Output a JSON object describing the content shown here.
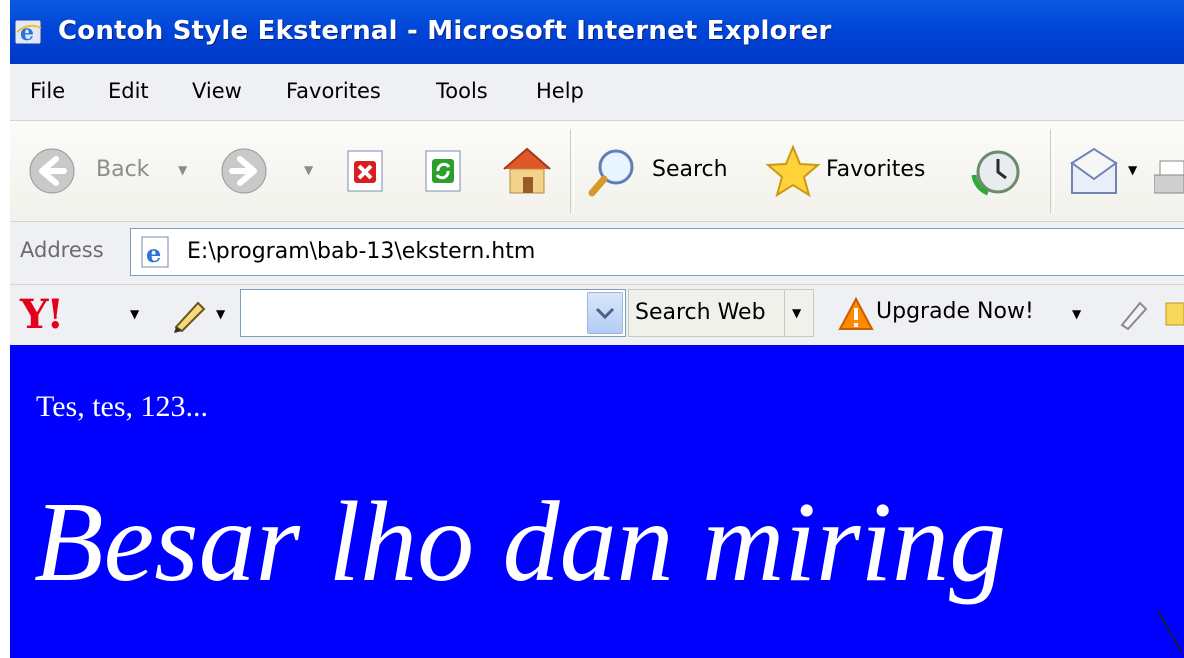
{
  "window": {
    "title": "Contoh Style Eksternal - Microsoft Internet Explorer",
    "title_bar_color": "#0046d8"
  },
  "menu": {
    "items": [
      "File",
      "Edit",
      "View",
      "Favorites",
      "Tools",
      "Help"
    ]
  },
  "toolbar": {
    "back_label": "Back",
    "search_label": "Search",
    "favorites_label": "Favorites",
    "icons": [
      "back-icon",
      "forward-icon",
      "stop-icon",
      "refresh-icon",
      "home-icon",
      "search-icon",
      "favorites-icon",
      "history-icon",
      "mail-icon",
      "print-icon"
    ]
  },
  "address": {
    "label": "Address",
    "value": "E:\\program\\bab-13\\ekstern.htm"
  },
  "yahoo": {
    "logo": "Y!",
    "search_value": "",
    "search_web_label": "Search Web",
    "upgrade_label": "Upgrade Now!"
  },
  "content": {
    "background": "#0000ff",
    "text_color": "#ffffff",
    "line1": "Tes, tes, 123...",
    "line2": "Besar lho dan miring"
  }
}
